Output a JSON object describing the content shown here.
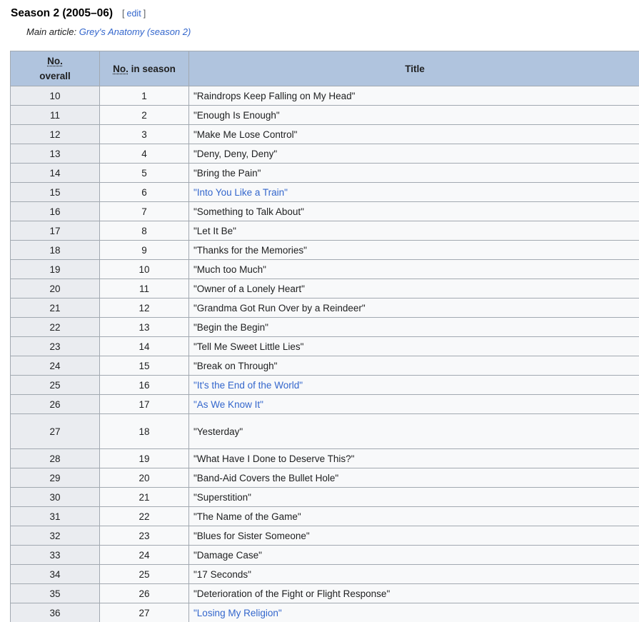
{
  "section": {
    "title": "Season 2 (2005–06)",
    "edit_open": "[",
    "edit_label": "edit",
    "edit_close": "]"
  },
  "hatnote": {
    "prefix": "Main article: ",
    "link_text": "Grey's Anatomy (season 2)"
  },
  "table": {
    "headers": {
      "overall_abbr": "No.",
      "overall_rest": "overall",
      "season_abbr": "No.",
      "season_rest": " in season",
      "title": "Title"
    },
    "rows": [
      {
        "overall": "10",
        "season": "1",
        "title": "Raindrops Keep Falling on My Head",
        "linked": false
      },
      {
        "overall": "11",
        "season": "2",
        "title": "Enough Is Enough",
        "linked": false
      },
      {
        "overall": "12",
        "season": "3",
        "title": "Make Me Lose Control",
        "linked": false
      },
      {
        "overall": "13",
        "season": "4",
        "title": "Deny, Deny, Deny",
        "linked": false
      },
      {
        "overall": "14",
        "season": "5",
        "title": "Bring the Pain",
        "linked": false
      },
      {
        "overall": "15",
        "season": "6",
        "title": "Into You Like a Train",
        "linked": true
      },
      {
        "overall": "16",
        "season": "7",
        "title": "Something to Talk About",
        "linked": false
      },
      {
        "overall": "17",
        "season": "8",
        "title": "Let It Be",
        "linked": false
      },
      {
        "overall": "18",
        "season": "9",
        "title": "Thanks for the Memories",
        "linked": false
      },
      {
        "overall": "19",
        "season": "10",
        "title": "Much too Much",
        "linked": false
      },
      {
        "overall": "20",
        "season": "11",
        "title": "Owner of a Lonely Heart",
        "linked": false
      },
      {
        "overall": "21",
        "season": "12",
        "title": "Grandma Got Run Over by a Reindeer",
        "linked": false
      },
      {
        "overall": "22",
        "season": "13",
        "title": "Begin the Begin",
        "linked": false
      },
      {
        "overall": "23",
        "season": "14",
        "title": "Tell Me Sweet Little Lies",
        "linked": false
      },
      {
        "overall": "24",
        "season": "15",
        "title": "Break on Through",
        "linked": false
      },
      {
        "overall": "25",
        "season": "16",
        "title": "It's the End of the World",
        "linked": true
      },
      {
        "overall": "26",
        "season": "17",
        "title": "As We Know It",
        "linked": true
      },
      {
        "overall": "27",
        "season": "18",
        "title": "Yesterday",
        "linked": false,
        "tall": true
      },
      {
        "overall": "28",
        "season": "19",
        "title": "What Have I Done to Deserve This?",
        "linked": false
      },
      {
        "overall": "29",
        "season": "20",
        "title": "Band-Aid Covers the Bullet Hole",
        "linked": false
      },
      {
        "overall": "30",
        "season": "21",
        "title": "Superstition",
        "linked": false
      },
      {
        "overall": "31",
        "season": "22",
        "title": "The Name of the Game",
        "linked": false
      },
      {
        "overall": "32",
        "season": "23",
        "title": "Blues for Sister Someone",
        "linked": false
      },
      {
        "overall": "33",
        "season": "24",
        "title": "Damage Case",
        "linked": false
      },
      {
        "overall": "34",
        "season": "25",
        "title": "17 Seconds",
        "linked": false
      },
      {
        "overall": "35",
        "season": "26",
        "title": "Deterioration of the Fight or Flight Response",
        "linked": false
      },
      {
        "overall": "36",
        "season": "27",
        "title": "Losing My Religion",
        "linked": true
      }
    ]
  },
  "colors": {
    "header_bg": "#b0c4de",
    "link": "#3366cc",
    "first_col_bg": "#eaecf0",
    "cell_bg": "#f8f9fa",
    "border": "#a2a9b1"
  }
}
